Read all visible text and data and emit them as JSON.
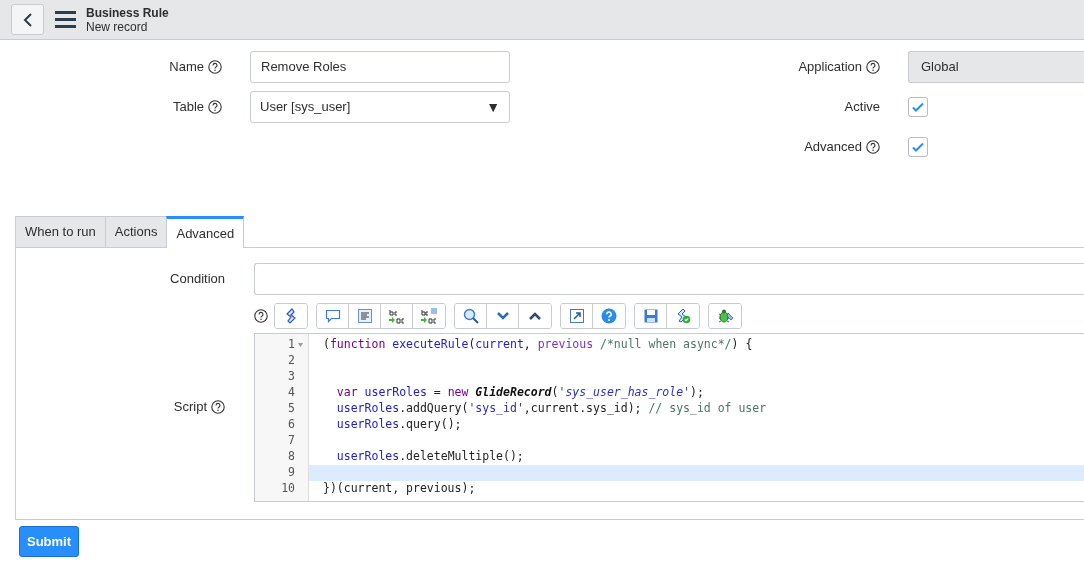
{
  "header": {
    "title": "Business Rule",
    "subtitle": "New record"
  },
  "left_fields": [
    {
      "kind": "text",
      "label": "Name",
      "help": true,
      "value": "Remove Roles"
    },
    {
      "kind": "select",
      "label": "Table",
      "help": true,
      "value": "User [sys_user]",
      "caret": "▼"
    }
  ],
  "right_fields": [
    {
      "kind": "readonly",
      "label": "Application",
      "help": true,
      "value": "Global"
    },
    {
      "kind": "checkbox",
      "label": "Active",
      "help": false,
      "checked": true
    },
    {
      "kind": "checkbox",
      "label": "Advanced",
      "help": true,
      "checked": true
    }
  ],
  "tabs": [
    {
      "label": "When to run",
      "selected": false
    },
    {
      "label": "Actions",
      "selected": false
    },
    {
      "label": "Advanced",
      "selected": true
    }
  ],
  "condition": {
    "label": "Condition",
    "help": false
  },
  "script": {
    "label": "Script",
    "help": true,
    "lines": [
      {
        "number": "1",
        "fold": true,
        "active": false,
        "tokens": [
          {
            "kind": "plain",
            "text": "("
          },
          {
            "kind": "keyword",
            "text": "function "
          },
          {
            "kind": "def",
            "text": "executeRule"
          },
          {
            "kind": "plain",
            "text": "("
          },
          {
            "kind": "var",
            "text": "current"
          },
          {
            "kind": "plain",
            "text": ", "
          },
          {
            "kind": "param",
            "text": "previous "
          },
          {
            "kind": "comment",
            "text": "/*null when async*/"
          },
          {
            "kind": "plain",
            "text": ") {"
          }
        ]
      },
      {
        "number": "2",
        "fold": false,
        "active": false
      },
      {
        "number": "3",
        "fold": false,
        "active": false
      },
      {
        "number": "4",
        "fold": false,
        "active": false,
        "tokens": [
          {
            "kind": "keyword",
            "text": "  var "
          },
          {
            "kind": "def",
            "text": "userRoles"
          },
          {
            "kind": "plain",
            "text": " = "
          },
          {
            "kind": "keyword",
            "text": "new "
          },
          {
            "kind": "class",
            "text": "GlideRecord"
          },
          {
            "kind": "plain",
            "text": "("
          },
          {
            "kind": "string-em",
            "text": "'sys_user_has_role'"
          },
          {
            "kind": "plain",
            "text": ");"
          }
        ]
      },
      {
        "number": "5",
        "fold": false,
        "active": false,
        "tokens": [
          {
            "kind": "var",
            "text": "  userRoles"
          },
          {
            "kind": "plain",
            "text": ".addQuery("
          },
          {
            "kind": "string",
            "text": "'sys_id'"
          },
          {
            "kind": "plain",
            "text": ",current.sys_id); "
          },
          {
            "kind": "comment",
            "text": "// sys_id of user"
          }
        ]
      },
      {
        "number": "6",
        "fold": false,
        "active": false,
        "tokens": [
          {
            "kind": "var",
            "text": "  userRoles"
          },
          {
            "kind": "plain",
            "text": ".query();"
          }
        ]
      },
      {
        "number": "7",
        "fold": false,
        "active": false
      },
      {
        "number": "8",
        "fold": false,
        "active": false,
        "tokens": [
          {
            "kind": "var",
            "text": "  userRoles"
          },
          {
            "kind": "plain",
            "text": ".deleteMultiple();"
          }
        ]
      },
      {
        "number": "9",
        "fold": false,
        "active": true
      },
      {
        "number": "10",
        "fold": false,
        "active": false,
        "tokens": [
          {
            "kind": "plain",
            "text": "})(current, previous);"
          }
        ]
      }
    ]
  },
  "submit": {
    "label": "Submit"
  }
}
